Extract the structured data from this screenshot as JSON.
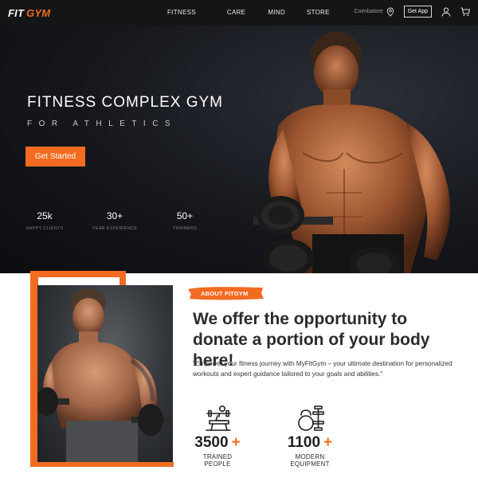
{
  "colors": {
    "accent": "#f26b21",
    "nav_bg": "#141517",
    "hero_bg": "#15171c",
    "text_dark": "#2b2b2b"
  },
  "brand": {
    "part1": "FIT",
    "part2": "GYM"
  },
  "nav": {
    "links": [
      "FITNESS",
      "CARE",
      "MIND",
      "STORE"
    ],
    "location": "Coimbatore",
    "get_app": "Get App",
    "icons": [
      "location-pin-icon",
      "user-icon",
      "cart-icon"
    ]
  },
  "hero": {
    "title": "FITNESS COMPLEX GYM",
    "subtitle": "FOR ATHLETICS",
    "cta": "Get Started",
    "stats": [
      {
        "value": "25k",
        "label": "HAPPY CLIENTS"
      },
      {
        "value": "30+",
        "label": "YEAR EXPERIENCE"
      },
      {
        "value": "50+",
        "label": "TRAINERS"
      }
    ]
  },
  "about": {
    "badge": "ABOUT FITGYM",
    "title": "We offer the opportunity to donate a portion of your body here!",
    "description": "\"Empower your fitness journey with MyFitGym – your ultimate destination for personalized workouts and expert guidance tailored to your goals and abilities.\"",
    "features": [
      {
        "icon": "bench-press-icon",
        "value": "3500",
        "plus": "+",
        "label": "TRAINED PEOPLE"
      },
      {
        "icon": "kettlebell-icon",
        "value": "1100",
        "plus": "+",
        "label": "MODERN EQUIPMENT"
      }
    ]
  }
}
